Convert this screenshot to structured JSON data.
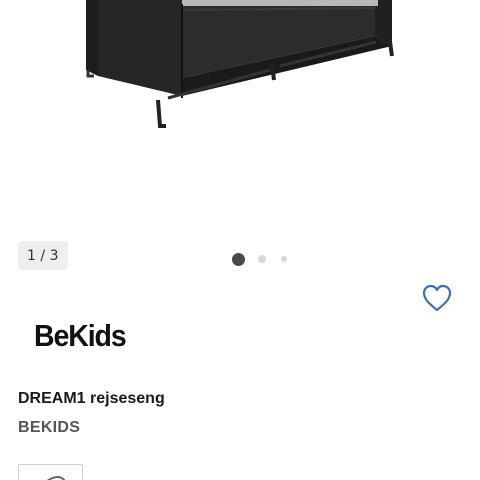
{
  "gallery": {
    "image_alt": "DREAM1 rejseseng",
    "counter": {
      "current": "1",
      "separator": "/",
      "total": "3"
    },
    "dots": 3,
    "active_dot": 1
  },
  "favorite": {
    "icon": "heart-outline-icon",
    "color": "#3b6fb6"
  },
  "brand": {
    "logo_text": "BeKids",
    "name": "BEKIDS"
  },
  "product": {
    "title": "DREAM1 rejseseng"
  }
}
